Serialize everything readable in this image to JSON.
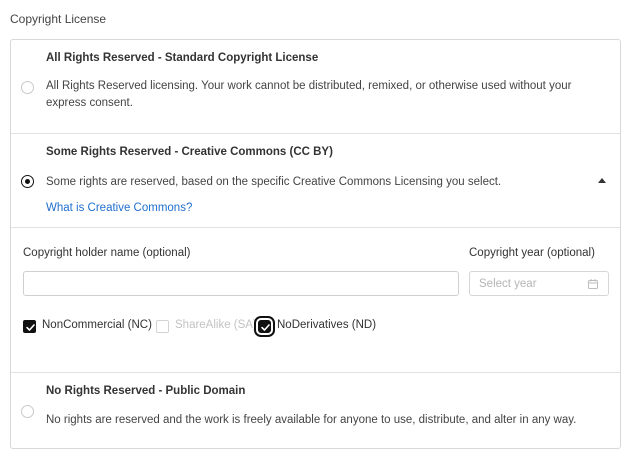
{
  "section": {
    "label": "Copyright License"
  },
  "options": [
    {
      "title": "All Rights Reserved - Standard Copyright License",
      "description": "All Rights Reserved licensing. Your work cannot be distributed, remixed, or otherwise used without your express consent.",
      "selected": false
    },
    {
      "title": "Some Rights Reserved - Creative Commons (CC BY)",
      "description": "Some rights are reserved, based on the specific Creative Commons Licensing you select.",
      "link": "What is Creative Commons?",
      "selected": true,
      "expanded": true
    },
    {
      "title": "No Rights Reserved - Public Domain",
      "description": "No rights are reserved and the work is freely available for anyone to use, distribute, and alter in any way.",
      "selected": false
    }
  ],
  "form": {
    "holder_label": "Copyright holder name (optional)",
    "holder_value": "",
    "year_label": "Copyright year (optional)",
    "year_placeholder": "Select year"
  },
  "checkboxes": [
    {
      "label": "NonCommercial (NC)",
      "checked": true,
      "disabled": false
    },
    {
      "label": "ShareAlike (SA)",
      "checked": false,
      "disabled": true
    },
    {
      "label": "NoDerivatives (ND)",
      "checked": true,
      "disabled": false,
      "focused": true
    }
  ],
  "icons": {
    "collapse": "chevron-up-icon",
    "calendar": "calendar-icon",
    "check": "check-icon"
  },
  "colors": {
    "link": "#1f6fcf",
    "selected": "#111111",
    "border": "#d8d8d8"
  }
}
